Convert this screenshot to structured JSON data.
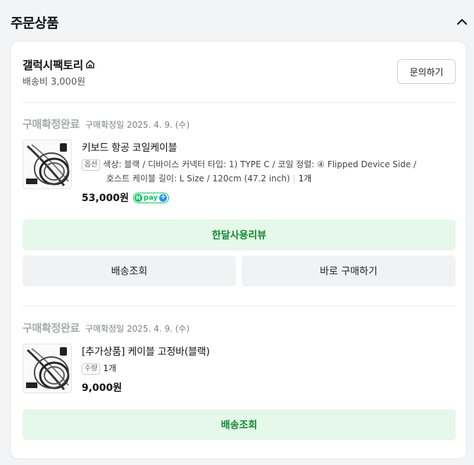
{
  "section": {
    "title": "주문상품"
  },
  "seller": {
    "name": "갤럭시팩토리",
    "shipping_fee": "배송비 3,000원",
    "inquiry_label": "문의하기"
  },
  "orders": [
    {
      "status": "구매확정완료",
      "date": "구매확정일 2025. 4. 9. (수)",
      "product_name": "키보드 항공 코일케이블",
      "option_tag": "옵션",
      "option_text_1": "색상: 블랙 / 디바이스 커넥터 타입: 1) TYPE C / 코일 정렬: ④ Flipped Device Side /",
      "option_text_2": "호스트 케이블 길이: L Size / 120cm (47.2 inch)",
      "quantity": "1개",
      "price": "53,000원",
      "pay_badge": "pay",
      "primary_button": "한달사용리뷰",
      "secondary_buttons": [
        "배송조회",
        "바로 구매하기"
      ]
    },
    {
      "status": "구매확정완료",
      "date": "구매확정일 2025. 4. 9. (수)",
      "product_name": "[추가상품] 케이블 고정바(블랙)",
      "option_tag": "수량",
      "quantity": "1개",
      "price": "9,000원",
      "primary_button": "배송조회"
    }
  ],
  "colors": {
    "accent_green": "#108a2e",
    "green_bg": "#e5f8e9",
    "status_gray": "#a7a9ad",
    "npay_green": "#03c75a"
  }
}
